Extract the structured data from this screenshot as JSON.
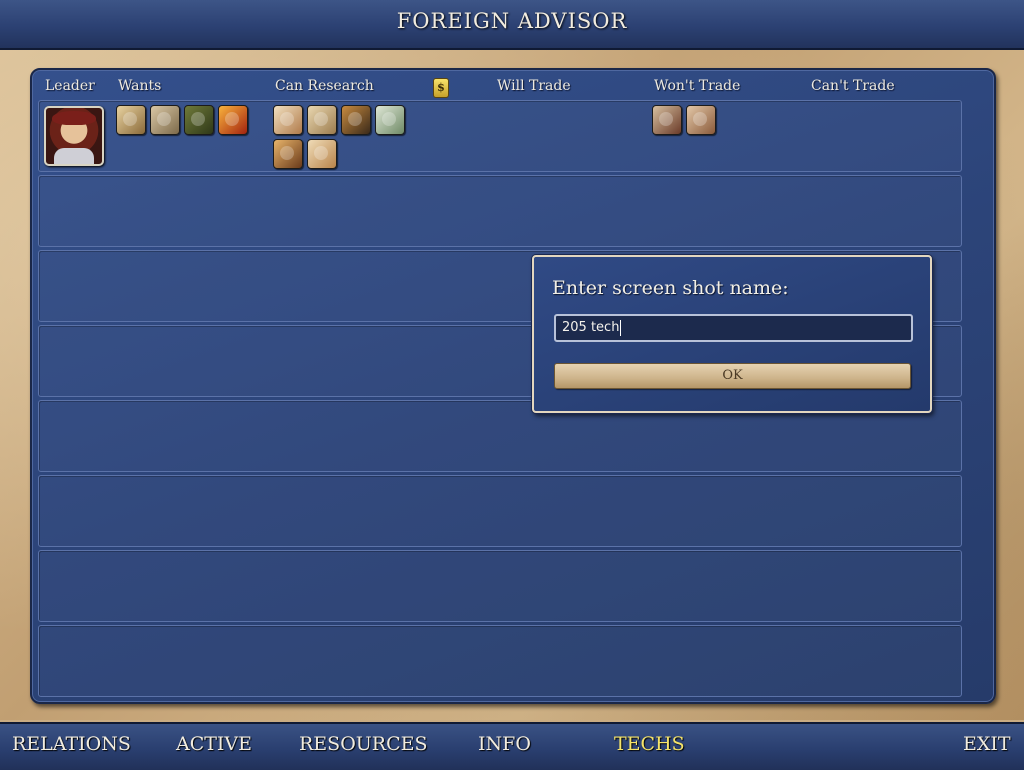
{
  "title": "FOREIGN ADVISOR",
  "columns": {
    "leader": "Leader",
    "wants": "Wants",
    "can_research": "Can Research",
    "gold_icon": "gold-coin-icon",
    "will_trade": "Will Trade",
    "wont_trade": "Won't Trade",
    "cant_trade": "Can't Trade"
  },
  "civ_row": {
    "leader_portrait": "leader-portrait-icon",
    "wants_icons": [
      "tech-philosophy-icon",
      "tech-code-of-laws-icon",
      "tech-currency-icon",
      "tech-iron-working-icon"
    ],
    "can_research_icons": [
      "tech-writing-icon",
      "tech-literacy-icon",
      "tech-mysticism-icon",
      "tech-trade-icon",
      "tech-horseback-icon",
      "tech-map-making-icon"
    ],
    "wont_trade_icons": [
      "tech-bronze-working-icon",
      "tech-masonry-icon"
    ]
  },
  "dialog": {
    "prompt": "Enter screen shot name:",
    "input_value": "205 tech",
    "ok_label": "OK"
  },
  "nav": {
    "relations": "RELATIONS",
    "active": "ACTIVE",
    "resources": "RESOURCES",
    "info": "INFO",
    "techs": "TECHS",
    "exit": "EXIT",
    "selected": "TECHS",
    "selected_color": "#f4e36a"
  }
}
